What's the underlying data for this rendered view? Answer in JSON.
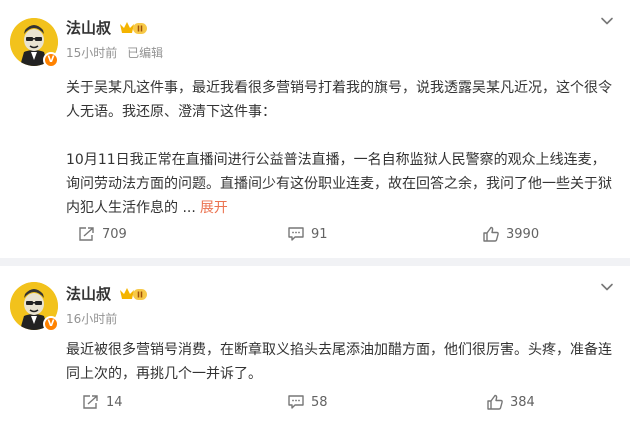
{
  "posts": [
    {
      "author": "法山叔",
      "time": "15小时前",
      "edited": "已编辑",
      "paragraphs": [
        "关于吴某凡这件事，最近我看很多营销号打着我的旗号，说我透露吴某凡近况，这个很令人无语。我还原、澄清下这件事：",
        "10月11日我正常在直播间进行公益普法直播，一名自称监狱人民警察的观众上线连麦，询问劳动法方面的问题。直播间少有这份职业连麦，故在回答之余，我问了他一些关于狱内犯人生活作息的 ..."
      ],
      "more": "展开",
      "reposts": "709",
      "comments": "91",
      "likes": "3990"
    },
    {
      "author": "法山叔",
      "time": "16小时前",
      "paragraphs": [
        "最近被很多营销号消费，在断章取义掐头去尾添油加醋方面，他们很厉害。头疼，准备连同上次的，再挑几个一并诉了。"
      ],
      "reposts": "14",
      "comments": "58",
      "likes": "384"
    }
  ],
  "icons": {
    "verified": "V",
    "level": "II",
    "chevron": "chevron-down-icon",
    "repost": "repost-icon",
    "comment": "comment-icon",
    "like": "like-icon"
  },
  "colors": {
    "avatar_bg": "#f2c21c",
    "verified_badge": "#ff8200",
    "expand_link": "#eb7350",
    "meta_text": "#939393"
  }
}
